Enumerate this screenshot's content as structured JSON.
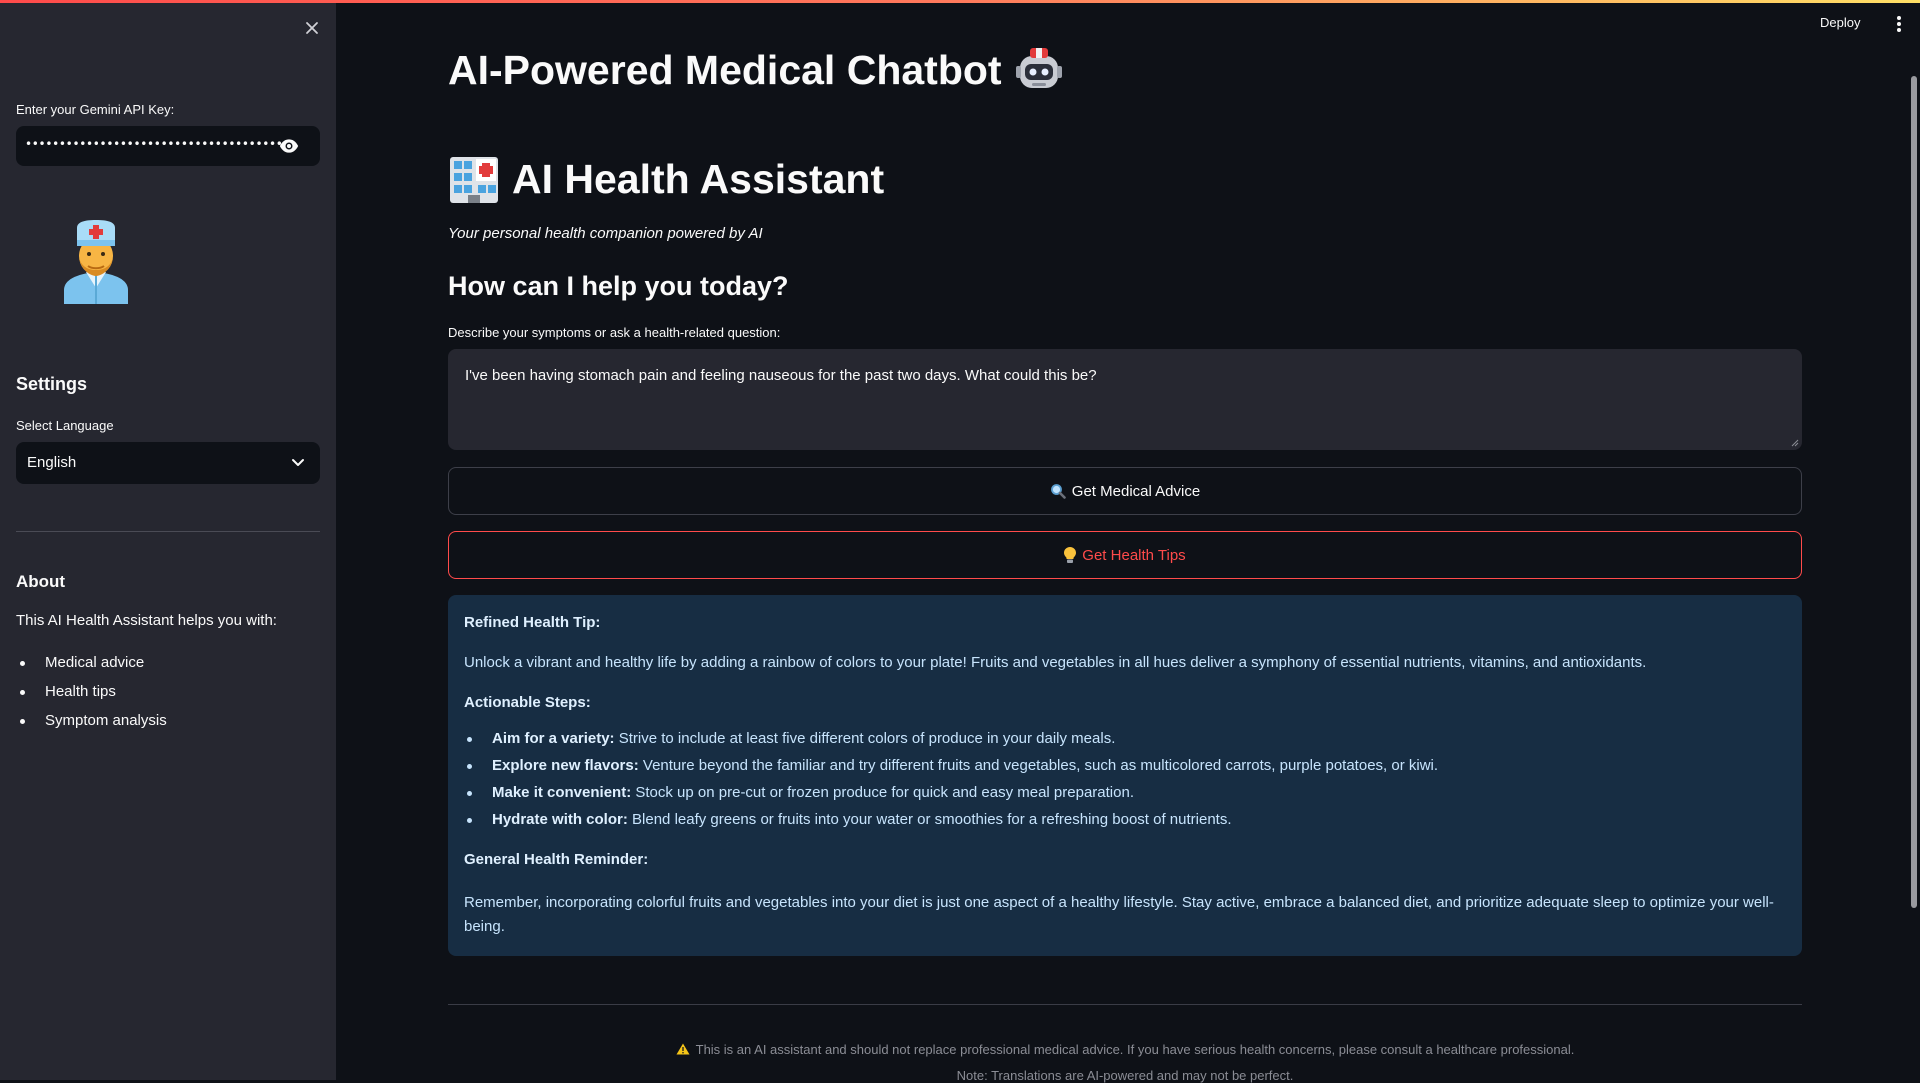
{
  "sidebar": {
    "api_key_label": "Enter your Gemini API Key:",
    "api_key_value": "•••••••••••••••••••••••••••••••••••••••",
    "settings_heading": "Settings",
    "language_label": "Select Language",
    "language_value": "English",
    "about_heading": "About",
    "about_text": "This AI Health Assistant helps you with:",
    "about_items": [
      "Medical advice",
      "Health tips",
      "Symptom analysis"
    ]
  },
  "header": {
    "deploy_label": "Deploy"
  },
  "main": {
    "title": "AI-Powered Medical Chatbot",
    "app_heading": "AI Health Assistant",
    "subtitle": "Your personal health companion powered by AI",
    "help_heading": "How can I help you today?",
    "input_label": "Describe your symptoms or ask a health-related question:",
    "input_value": "I've been having stomach pain and feeling nauseous for the past two days. What could this be?",
    "advice_button": "Get Medical Advice",
    "tips_button": "Get Health Tips"
  },
  "result": {
    "tip_heading": "Refined Health Tip:",
    "tip_text": "Unlock a vibrant and healthy life by adding a rainbow of colors to your plate! Fruits and vegetables in all hues deliver a symphony of essential nutrients, vitamins, and antioxidants.",
    "steps_heading": "Actionable Steps:",
    "steps": [
      {
        "title": "Aim for a variety:",
        "text": "Strive to include at least five different colors of produce in your daily meals."
      },
      {
        "title": "Explore new flavors:",
        "text": "Venture beyond the familiar and try different fruits and vegetables, such as multicolored carrots, purple potatoes, or kiwi."
      },
      {
        "title": "Make it convenient:",
        "text": "Stock up on pre-cut or frozen produce for quick and easy meal preparation."
      },
      {
        "title": "Hydrate with color:",
        "text": "Blend leafy greens or fruits into your water or smoothies for a refreshing boost of nutrients."
      }
    ],
    "reminder_heading": "General Health Reminder:",
    "reminder_text": "Remember, incorporating colorful fruits and vegetables into your diet is just one aspect of a healthy lifestyle. Stay active, embrace a balanced diet, and prioritize adequate sleep to optimize your well-being."
  },
  "footer": {
    "disclaimer": "This is an AI assistant and should not replace professional medical advice. If you have serious health concerns, please consult a healthcare professional.",
    "translation_note": "Note: Translations are AI-powered and may not be perfect."
  },
  "icons": {
    "close": "close-icon",
    "eye": "eye-icon",
    "doctor": "doctor-icon",
    "chevron": "chevron-down-icon",
    "robot": "robot-icon",
    "hospital": "hospital-icon",
    "search": "magnifying-glass-icon",
    "bulb": "light-bulb-icon",
    "warning": "warning-icon",
    "menu": "kebab-menu-icon"
  },
  "colors": {
    "background": "#0e1117",
    "sidebar": "#262730",
    "accent": "#ff4b4b",
    "info_box": "#172d43",
    "info_text": "#c7e4fd"
  }
}
